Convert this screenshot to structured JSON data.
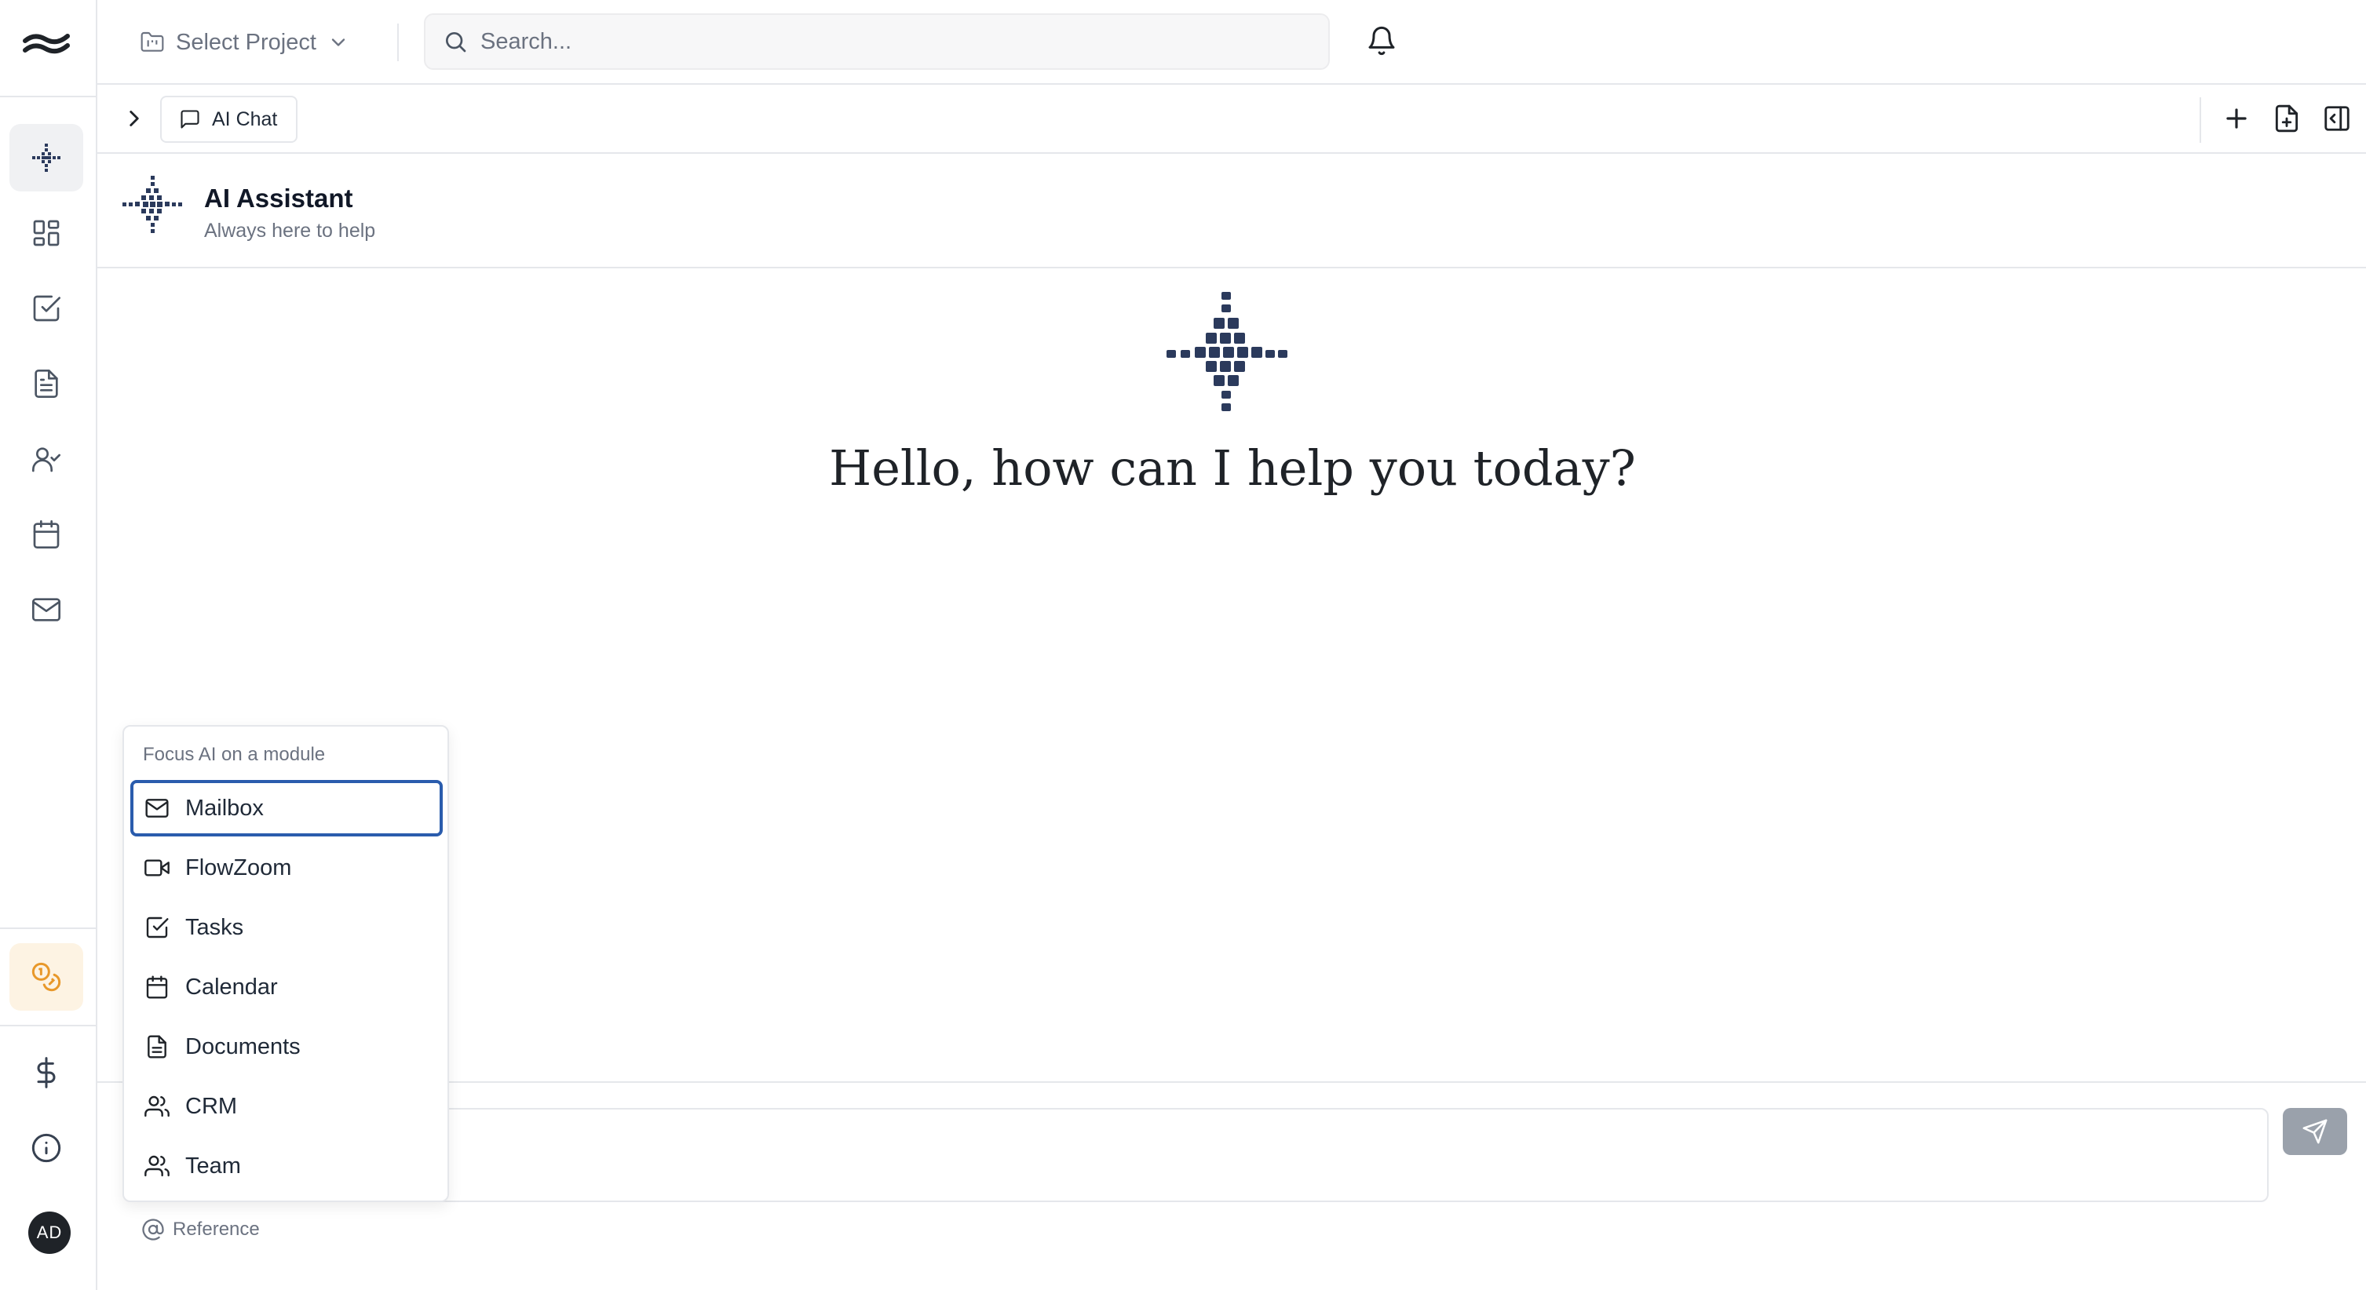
{
  "header": {
    "project_selector": "Select Project",
    "search_placeholder": "Search..."
  },
  "tabs": [
    {
      "label": "AI Chat"
    }
  ],
  "assistant": {
    "title": "AI Assistant",
    "subtitle": "Always here to help",
    "greeting": "Hello, how can I help you today?"
  },
  "sidebar": {
    "items": [
      {
        "name": "ai-assistant",
        "icon": "sparkle-logo-icon",
        "active": true
      },
      {
        "name": "dashboard",
        "icon": "dashboard-grid-icon"
      },
      {
        "name": "tasks",
        "icon": "checkbox-icon"
      },
      {
        "name": "documents",
        "icon": "document-icon"
      },
      {
        "name": "crm",
        "icon": "user-check-icon"
      },
      {
        "name": "calendar",
        "icon": "calendar-icon"
      },
      {
        "name": "mailbox",
        "icon": "mail-icon"
      }
    ],
    "bottom": [
      {
        "name": "coins",
        "icon": "coins-icon"
      },
      {
        "name": "billing",
        "icon": "dollar-icon"
      },
      {
        "name": "info",
        "icon": "info-icon"
      }
    ],
    "avatar_initials": "AD"
  },
  "focus_menu": {
    "heading": "Focus AI on a module",
    "items": [
      {
        "label": "Mailbox",
        "icon": "mail-icon",
        "selected": true
      },
      {
        "label": "FlowZoom",
        "icon": "video-icon"
      },
      {
        "label": "Tasks",
        "icon": "checkbox-icon"
      },
      {
        "label": "Calendar",
        "icon": "calendar-icon"
      },
      {
        "label": "Documents",
        "icon": "document-icon"
      },
      {
        "label": "CRM",
        "icon": "users-icon"
      },
      {
        "label": "Team",
        "icon": "users-icon"
      }
    ]
  },
  "composer": {
    "reference_label": "Reference"
  },
  "colors": {
    "accent_selected_border": "#2a5cad",
    "logo_navy": "#2b3a5c",
    "coins_orange": "#e8982a",
    "send_button": "#9aa1ab"
  }
}
